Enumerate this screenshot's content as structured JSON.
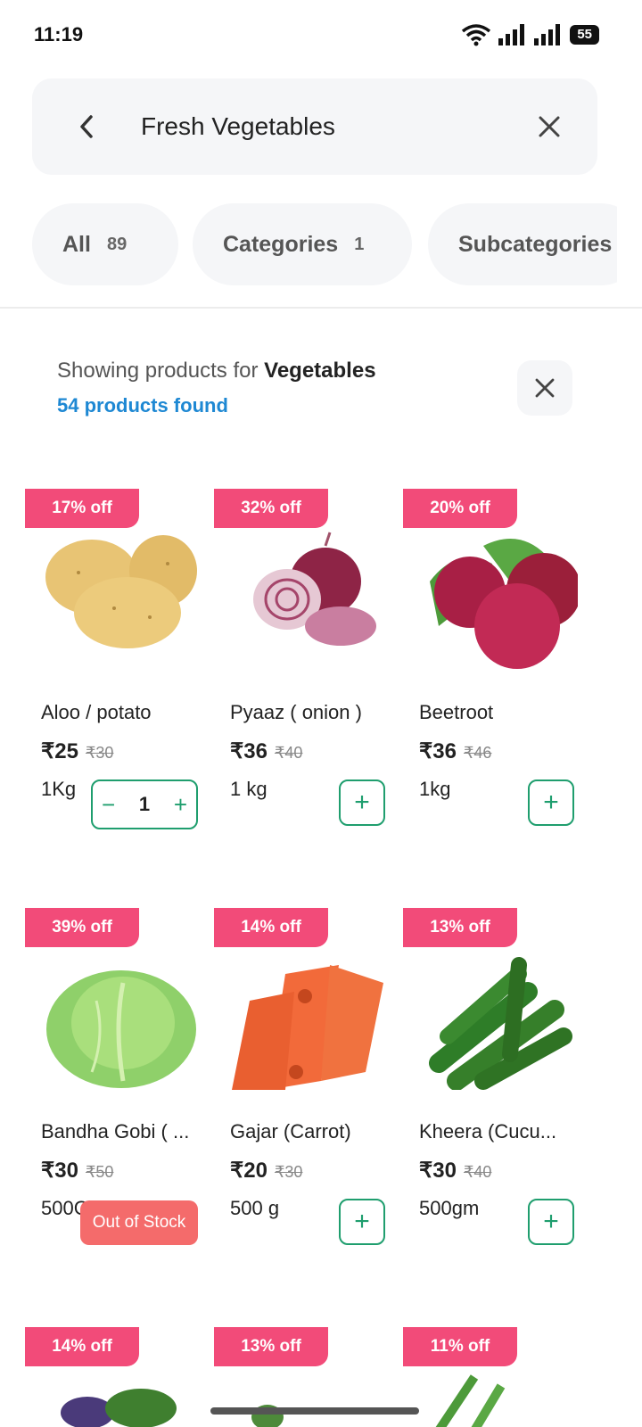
{
  "status": {
    "time": "11:19",
    "battery": "55"
  },
  "search": {
    "query": "Fresh Vegetables"
  },
  "chips": [
    {
      "label": "All",
      "count": "89"
    },
    {
      "label": "Categories",
      "count": "1"
    },
    {
      "label": "Subcategories",
      "count": ""
    }
  ],
  "filter": {
    "prefix": "Showing products for",
    "category": "Vegetables",
    "found": "54 products found"
  },
  "products": [
    {
      "badge": "17% off",
      "name": "Aloo / potato",
      "price": "₹25",
      "mrp": "₹30",
      "qty": "1Kg",
      "cart": "1"
    },
    {
      "badge": "32% off",
      "name": "Pyaaz ( onion )",
      "price": "₹36",
      "mrp": "₹40",
      "qty": "1 kg"
    },
    {
      "badge": "20% off",
      "name": "Beetroot",
      "price": "₹36",
      "mrp": "₹46",
      "qty": "1kg"
    },
    {
      "badge": "39% off",
      "name": "Bandha Gobi ( ...",
      "price": "₹30",
      "mrp": "₹50",
      "qty": "500G",
      "stock": "Out of Stock"
    },
    {
      "badge": "14% off",
      "name": "Gajar (Carrot)",
      "price": "₹20",
      "mrp": "₹30",
      "qty": "500 g"
    },
    {
      "badge": "13% off",
      "name": "Kheera (Cucu...",
      "price": "₹30",
      "mrp": "₹40",
      "qty": "500gm"
    },
    {
      "badge": "14% off"
    },
    {
      "badge": "13% off"
    },
    {
      "badge": "11% off"
    }
  ],
  "colors": {
    "badge": "#f24b79",
    "accent": "#1f9e6e",
    "link": "#1e88d3",
    "out_of_stock": "#f46b6b"
  }
}
